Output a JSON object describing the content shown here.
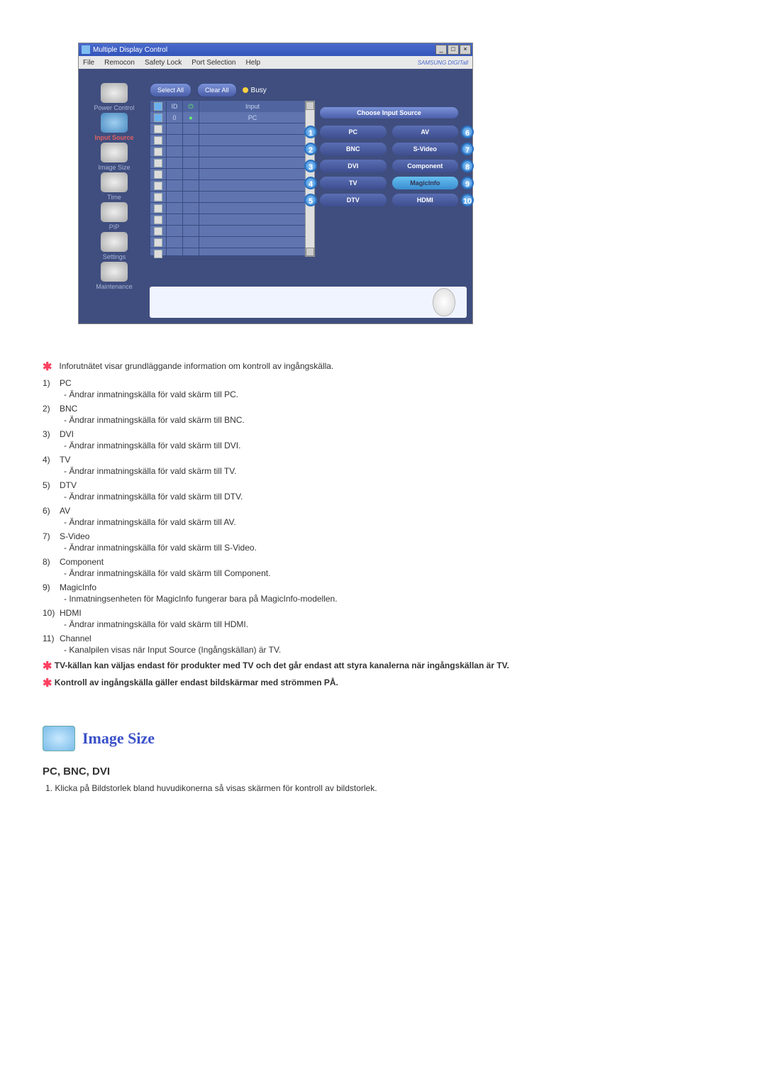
{
  "app": {
    "title": "Multiple Display Control",
    "brand": "SAMSUNG DIGITall",
    "menu": [
      "File",
      "Remocon",
      "Safety Lock",
      "Port Selection",
      "Help"
    ],
    "selectAll": "Select All",
    "clearAll": "Clear All",
    "busy": "Busy",
    "gridHeaders": {
      "id": "ID",
      "input": "Input"
    },
    "firstRow": {
      "id": "0",
      "input": "PC"
    },
    "panelTitle": "Choose Input Source",
    "sidebar": {
      "power": "Power Control",
      "input": "Input Source",
      "image": "Image Size",
      "time": "Time",
      "pip": "PIP",
      "settings": "Settings",
      "maint": "Maintenance"
    },
    "sources": {
      "pc": "PC",
      "av": "AV",
      "bnc": "BNC",
      "svideo": "S-Video",
      "dvi": "DVI",
      "comp": "Component",
      "tv": "TV",
      "magic": "MagicInfo",
      "dtv": "DTV",
      "hdmi": "HDMI"
    },
    "circles": {
      "c1": "1",
      "c2": "2",
      "c3": "3",
      "c4": "4",
      "c5": "5",
      "c6": "6",
      "c7": "7",
      "c8": "8",
      "c9": "9",
      "c10": "10"
    }
  },
  "intro_star": "Inforutnätet visar grundläggande information om kontroll av ingångskälla.",
  "list": {
    "n1": "1)",
    "t1": "PC",
    "d1": "- Ändrar inmatningskälla för vald skärm till PC.",
    "n2": "2)",
    "t2": "BNC",
    "d2": "- Ändrar inmatningskälla för vald skärm till BNC.",
    "n3": "3)",
    "t3": "DVI",
    "d3": "- Ändrar inmatningskälla för vald skärm till DVI.",
    "n4": "4)",
    "t4": "TV",
    "d4": "- Ändrar inmatningskälla för vald skärm till TV.",
    "n5": "5)",
    "t5": "DTV",
    "d5": "- Ändrar inmatningskälla för vald skärm till DTV.",
    "n6": "6)",
    "t6": "AV",
    "d6": "- Ändrar inmatningskälla för vald skärm till AV.",
    "n7": "7)",
    "t7": "S-Video",
    "d7": "- Ändrar inmatningskälla för vald skärm till S-Video.",
    "n8": "8)",
    "t8": "Component",
    "d8": "- Ändrar inmatningskälla för vald skärm till Component.",
    "n9": "9)",
    "t9": "MagicInfo",
    "d9": "- Inmatningsenheten för MagicInfo fungerar bara på MagicInfo-modellen.",
    "n10": "10)",
    "t10": "HDMI",
    "d10": "- Ändrar inmatningskälla för vald skärm till HDMI.",
    "n11": "11)",
    "t11": "Channel",
    "d11": "- Kanalpilen visas när Input Source (Ingångskällan) är TV."
  },
  "note1": "TV-källan kan väljas endast för produkter med TV och det går endast att styra kanalerna när ingångskällan är TV.",
  "note2": "Kontroll av ingångskälla gäller endast bildskärmar med strömmen PÅ.",
  "section": {
    "title": "Image Size",
    "sub": "PC, BNC, DVI",
    "step1": "1. Klicka på Bildstorlek bland huvudikonerna så visas skärmen för kontroll av bildstorlek."
  }
}
